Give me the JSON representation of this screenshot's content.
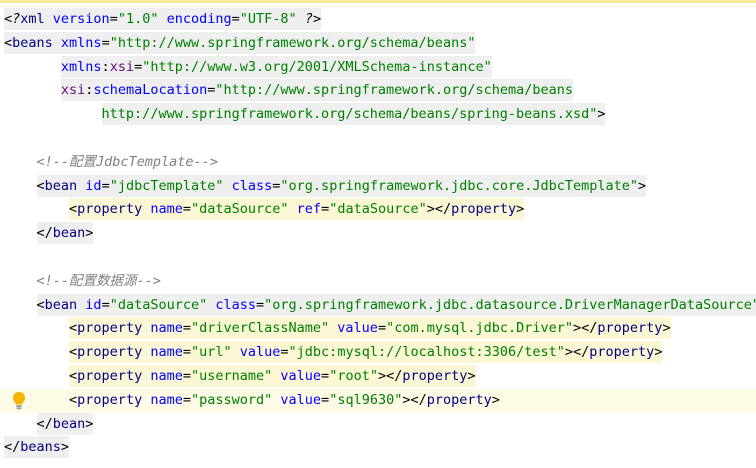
{
  "editor": {
    "lines": [
      {
        "segments": [
          {
            "cls": "t-pi",
            "text": "<?"
          },
          {
            "cls": "t-tag",
            "text": "xml "
          },
          {
            "cls": "t-attr",
            "text": "version"
          },
          {
            "cls": "t-punc",
            "text": "="
          },
          {
            "cls": "t-str",
            "text": "\"1.0\""
          },
          {
            "cls": "t-punc",
            "text": " "
          },
          {
            "cls": "t-attr",
            "text": "encoding"
          },
          {
            "cls": "t-punc",
            "text": "="
          },
          {
            "cls": "t-str",
            "text": "\"UTF-8\""
          },
          {
            "cls": "t-pi",
            "text": " ?>"
          }
        ],
        "indent": 0,
        "hl": "gray"
      },
      {
        "segments": [
          {
            "cls": "t-punc",
            "text": "<"
          },
          {
            "cls": "t-tag",
            "text": "beans "
          },
          {
            "cls": "t-attr",
            "text": "xmlns"
          },
          {
            "cls": "t-punc",
            "text": "="
          },
          {
            "cls": "t-str",
            "text": "\"http://www.springframework.org/schema/beans\""
          }
        ],
        "indent": 0,
        "hl": "gray"
      },
      {
        "segments": [
          {
            "cls": "t-attr",
            "text": "xmlns"
          },
          {
            "cls": "t-punc",
            "text": ":"
          },
          {
            "cls": "t-ns",
            "text": "xsi"
          },
          {
            "cls": "t-punc",
            "text": "="
          },
          {
            "cls": "t-str",
            "text": "\"http://www.w3.org/2001/XMLSchema-instance\""
          }
        ],
        "indent": 7,
        "hl": "gray"
      },
      {
        "segments": [
          {
            "cls": "t-ns",
            "text": "xsi"
          },
          {
            "cls": "t-punc",
            "text": ":"
          },
          {
            "cls": "t-attr",
            "text": "schemaLocation"
          },
          {
            "cls": "t-punc",
            "text": "="
          },
          {
            "cls": "t-str",
            "text": "\"http://www.springframework.org/schema/beans"
          }
        ],
        "indent": 7,
        "hl": "gray"
      },
      {
        "segments": [
          {
            "cls": "t-str",
            "text": "http://www.springframework.org/schema/beans/spring-beans.xsd\""
          },
          {
            "cls": "t-punc",
            "text": ">"
          }
        ],
        "indent": 12,
        "hl": "gray"
      },
      {
        "segments": [],
        "indent": 0,
        "hl": "none"
      },
      {
        "segments": [
          {
            "cls": "t-cmt",
            "text": "<!--配置JdbcTemplate-->"
          }
        ],
        "indent": 4,
        "hl": "none"
      },
      {
        "segments": [
          {
            "cls": "t-punc",
            "text": "<"
          },
          {
            "cls": "t-tag",
            "text": "bean "
          },
          {
            "cls": "t-attr",
            "text": "id"
          },
          {
            "cls": "t-punc",
            "text": "="
          },
          {
            "cls": "t-str",
            "text": "\"jdbcTemplate\""
          },
          {
            "cls": "t-punc",
            "text": " "
          },
          {
            "cls": "t-attr",
            "text": "class"
          },
          {
            "cls": "t-punc",
            "text": "="
          },
          {
            "cls": "t-str",
            "text": "\"org.springframework.jdbc.core.JdbcTemplate\""
          },
          {
            "cls": "t-punc",
            "text": ">"
          }
        ],
        "indent": 4,
        "hl": "gray"
      },
      {
        "segments": [
          {
            "cls": "t-punc",
            "text": "<"
          },
          {
            "cls": "t-tag",
            "text": "property "
          },
          {
            "cls": "t-attr",
            "text": "name"
          },
          {
            "cls": "t-punc",
            "text": "="
          },
          {
            "cls": "t-str",
            "text": "\"dataSource\""
          },
          {
            "cls": "t-punc",
            "text": " "
          },
          {
            "cls": "t-attr",
            "text": "ref"
          },
          {
            "cls": "t-punc",
            "text": "="
          },
          {
            "cls": "t-str",
            "text": "\"dataSource\""
          },
          {
            "cls": "t-punc",
            "text": "></"
          },
          {
            "cls": "t-tag",
            "text": "property"
          },
          {
            "cls": "t-punc",
            "text": ">"
          }
        ],
        "indent": 8,
        "hl": "yellow"
      },
      {
        "segments": [
          {
            "cls": "t-punc",
            "text": "</"
          },
          {
            "cls": "t-tag",
            "text": "bean"
          },
          {
            "cls": "t-punc",
            "text": ">"
          }
        ],
        "indent": 4,
        "hl": "gray"
      },
      {
        "segments": [],
        "indent": 0,
        "hl": "none"
      },
      {
        "segments": [
          {
            "cls": "t-cmt",
            "text": "<!--配置数据源-->"
          }
        ],
        "indent": 4,
        "hl": "none"
      },
      {
        "segments": [
          {
            "cls": "t-punc",
            "text": "<"
          },
          {
            "cls": "t-tag",
            "text": "bean "
          },
          {
            "cls": "t-attr",
            "text": "id"
          },
          {
            "cls": "t-punc",
            "text": "="
          },
          {
            "cls": "t-str",
            "text": "\"dataSource\""
          },
          {
            "cls": "t-punc",
            "text": " "
          },
          {
            "cls": "t-attr",
            "text": "class"
          },
          {
            "cls": "t-punc",
            "text": "="
          },
          {
            "cls": "t-str",
            "text": "\"org.springframework.jdbc.datasource.DriverManagerDataSource\""
          },
          {
            "cls": "t-punc",
            "text": ">"
          }
        ],
        "indent": 4,
        "hl": "gray"
      },
      {
        "segments": [
          {
            "cls": "t-punc",
            "text": "<"
          },
          {
            "cls": "t-tag",
            "text": "property "
          },
          {
            "cls": "t-attr",
            "text": "name"
          },
          {
            "cls": "t-punc",
            "text": "="
          },
          {
            "cls": "t-str",
            "text": "\"driverClassName\""
          },
          {
            "cls": "t-punc",
            "text": " "
          },
          {
            "cls": "t-attr",
            "text": "value"
          },
          {
            "cls": "t-punc",
            "text": "="
          },
          {
            "cls": "t-str",
            "text": "\"com.mysql.jdbc.Driver\""
          },
          {
            "cls": "t-punc",
            "text": "></"
          },
          {
            "cls": "t-tag",
            "text": "property"
          },
          {
            "cls": "t-punc",
            "text": ">"
          }
        ],
        "indent": 8,
        "hl": "yellow"
      },
      {
        "segments": [
          {
            "cls": "t-punc",
            "text": "<"
          },
          {
            "cls": "t-tag",
            "text": "property "
          },
          {
            "cls": "t-attr",
            "text": "name"
          },
          {
            "cls": "t-punc",
            "text": "="
          },
          {
            "cls": "t-str",
            "text": "\"url\""
          },
          {
            "cls": "t-punc",
            "text": " "
          },
          {
            "cls": "t-attr",
            "text": "value"
          },
          {
            "cls": "t-punc",
            "text": "="
          },
          {
            "cls": "t-str",
            "text": "\"jdbc:mysql://localhost:3306/test\""
          },
          {
            "cls": "t-punc",
            "text": "></"
          },
          {
            "cls": "t-tag",
            "text": "property"
          },
          {
            "cls": "t-punc",
            "text": ">"
          }
        ],
        "indent": 8,
        "hl": "yellow"
      },
      {
        "segments": [
          {
            "cls": "t-punc",
            "text": "<"
          },
          {
            "cls": "t-tag",
            "text": "property "
          },
          {
            "cls": "t-attr",
            "text": "name"
          },
          {
            "cls": "t-punc",
            "text": "="
          },
          {
            "cls": "t-str",
            "text": "\"username\""
          },
          {
            "cls": "t-punc",
            "text": " "
          },
          {
            "cls": "t-attr",
            "text": "value"
          },
          {
            "cls": "t-punc",
            "text": "="
          },
          {
            "cls": "t-str",
            "text": "\"root\""
          },
          {
            "cls": "t-punc",
            "text": "></"
          },
          {
            "cls": "t-tag",
            "text": "property"
          },
          {
            "cls": "t-punc",
            "text": ">"
          }
        ],
        "indent": 8,
        "hl": "yellow"
      },
      {
        "segments": [
          {
            "cls": "t-punc",
            "text": "<"
          },
          {
            "cls": "t-tag",
            "text": "property "
          },
          {
            "cls": "t-attr",
            "text": "name"
          },
          {
            "cls": "t-punc",
            "text": "="
          },
          {
            "cls": "t-str",
            "text": "\"password\""
          },
          {
            "cls": "t-punc",
            "text": " "
          },
          {
            "cls": "t-attr",
            "text": "value"
          },
          {
            "cls": "t-punc",
            "text": "="
          },
          {
            "cls": "t-str",
            "text": "\"sql9630\""
          },
          {
            "cls": "t-punc",
            "text": "></"
          },
          {
            "cls": "t-tag",
            "text": "property"
          },
          {
            "cls": "t-punc",
            "text": ">"
          }
        ],
        "indent": 8,
        "hl": "none",
        "current": true,
        "bulb": true
      },
      {
        "segments": [
          {
            "cls": "t-punc",
            "text": "</"
          },
          {
            "cls": "t-tag",
            "text": "bean"
          },
          {
            "cls": "t-punc",
            "text": ">"
          }
        ],
        "indent": 4,
        "hl": "gray"
      },
      {
        "segments": [
          {
            "cls": "t-punc",
            "text": "</"
          },
          {
            "cls": "t-tag",
            "text": "beans"
          },
          {
            "cls": "t-punc",
            "text": ">"
          }
        ],
        "indent": 0,
        "hl": "gray"
      }
    ],
    "icons": {
      "intention_bulb": "lightbulb-icon"
    },
    "colors": {
      "tag": "#000080",
      "attribute": "#0000ff",
      "string": "#008000",
      "namespace": "#660e7a",
      "comment": "#808080",
      "tag_highlight": "#efefef",
      "property_highlight": "#fbf7d5",
      "current_line": "#fdfbe6"
    }
  }
}
